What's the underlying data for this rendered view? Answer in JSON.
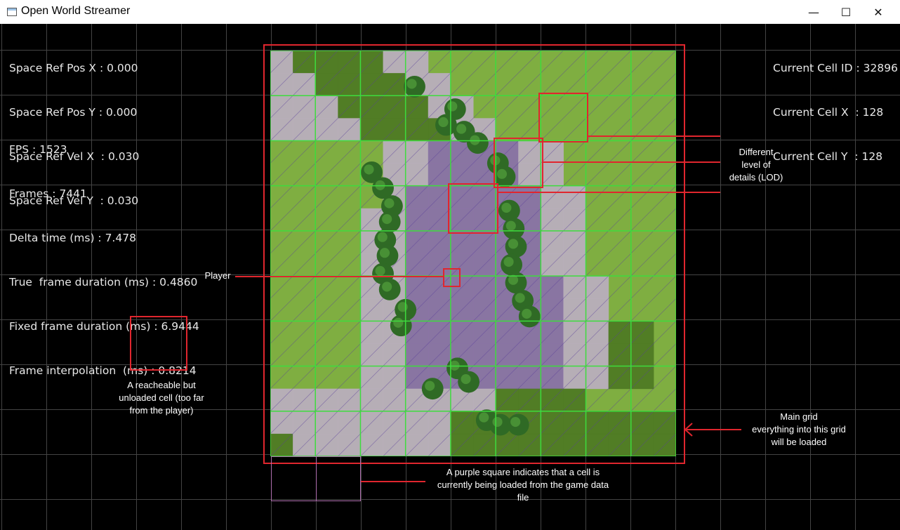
{
  "window": {
    "title": "Open World Streamer",
    "minimize_glyph": "—",
    "maximize_glyph": "☐",
    "close_glyph": "✕"
  },
  "stats_left": {
    "space_ref_pos_x": "Space Ref Pos X : 0.000",
    "space_ref_pos_y": "Space Ref Pos Y : 0.000",
    "space_ref_vel_x": "Space Ref Vel X  : 0.030",
    "space_ref_vel_y": "Space Ref Vel Y  : 0.030",
    "fps": "FPS : 1523",
    "frames": "Frames : 7441",
    "delta_time": "Delta time (ms) : 7.478",
    "true_frame_duration": "True  frame duration (ms) : 0.4860",
    "fixed_frame_duration": "Fixed frame duration (ms) : 6.9444",
    "frame_interpolation": "Frame interpolation  (ms) : 0.8214"
  },
  "stats_right": {
    "cell_id": "Current Cell ID : 32896",
    "cell_x": "Current Cell X  : 128",
    "cell_y": "Current Cell Y  : 128"
  },
  "annotations": {
    "lod_line1": "Different",
    "lod_line2": "level of",
    "lod_line3": "details (LOD)",
    "player": "Player",
    "unloaded_line1": "A reacheable but",
    "unloaded_line2": "unloaded cell (too far",
    "unloaded_line3": "from the player)",
    "main_grid_line1": "Main grid",
    "main_grid_line2": "everything into this grid",
    "main_grid_line3": "will be loaded",
    "purple_line1": "A purple square indicates that a cell is",
    "purple_line2": "currently being loaded from the game data",
    "purple_line3": "file"
  },
  "colors": {
    "grass": "#7fae41",
    "dark_grass": "#4f7a24",
    "stone": "#b9aebd",
    "purple_tint": "#8a72a8",
    "tree": "#2f6a25",
    "grid_green": "#3ddc3d",
    "annotation_red": "#e0262e",
    "loading_purple": "#b070b0"
  }
}
